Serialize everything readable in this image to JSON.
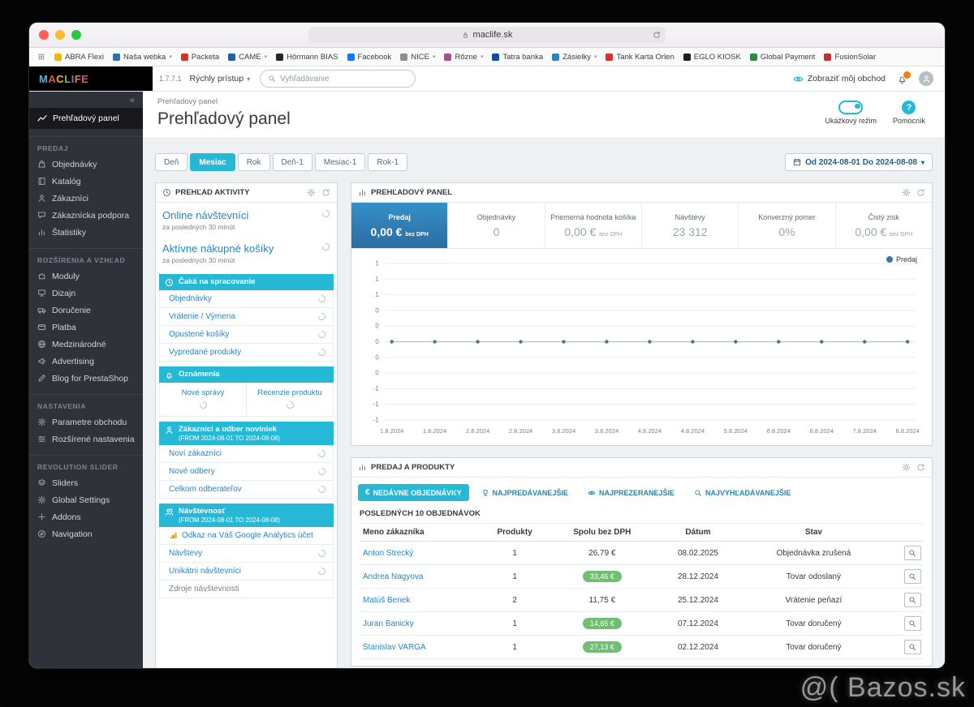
{
  "watermark": "@( Bazos.sk",
  "browser": {
    "address": "maclife.sk",
    "bookmarks_bar": {
      "items": [
        {
          "label": "ABRA Flexi",
          "color": "#f2b705",
          "menu": false
        },
        {
          "label": "Naša webka",
          "color": "#2f6fb2",
          "menu": true
        },
        {
          "label": "Packeta",
          "color": "#d6312b",
          "menu": false
        },
        {
          "label": "CAME",
          "color": "#1b5fae",
          "menu": true
        },
        {
          "label": "Hörmann BIAS",
          "color": "#23272b",
          "menu": false
        },
        {
          "label": "Facebook",
          "color": "#1877f2",
          "menu": false
        },
        {
          "label": "NICE",
          "color": "#8a8f94",
          "menu": true
        },
        {
          "label": "Rôzne",
          "color": "#b04a98",
          "menu": true
        },
        {
          "label": "Tatra banka",
          "color": "#0b4ea2",
          "menu": false
        },
        {
          "label": "Zásielky",
          "color": "#2f80c2",
          "menu": true
        },
        {
          "label": "Tank Karta Orlen",
          "color": "#d6312b",
          "menu": false
        },
        {
          "label": "EGLO KIOSK",
          "color": "#1c1f22",
          "menu": false
        },
        {
          "label": "Global Payment",
          "color": "#2e8b46",
          "menu": false
        },
        {
          "label": "FusionSolar",
          "color": "#c62f2f",
          "menu": false
        }
      ]
    }
  },
  "admin_header": {
    "logo_letters": [
      {
        "ch": "M",
        "color": "#49b8e5"
      },
      {
        "ch": "A",
        "color": "#e8503a"
      },
      {
        "ch": "C",
        "color": "#f5b81c"
      },
      {
        "ch": "L",
        "color": "#6cbf4b"
      },
      {
        "ch": "I",
        "color": "#9a66c6"
      },
      {
        "ch": "F",
        "color": "#f07f28"
      },
      {
        "ch": "E",
        "color": "#e24a7a"
      }
    ],
    "version": "1.7.7.1",
    "quick_access_label": "Rýchly prístup",
    "search_placeholder": "Vyhľadávanie",
    "view_shop_label": "Zobraziť môj obchod"
  },
  "sidebar": {
    "collapse_glyph": "«",
    "active_item": {
      "label": "Prehľadový panel",
      "icon": "chart-line"
    },
    "sections": [
      {
        "heading": "PREDAJ",
        "items": [
          {
            "label": "Objednávky",
            "icon": "bag"
          },
          {
            "label": "Katalóg",
            "icon": "book"
          },
          {
            "label": "Zákazníci",
            "icon": "user"
          },
          {
            "label": "Zákaznícka podpora",
            "icon": "chat"
          },
          {
            "label": "Štatistiky",
            "icon": "bars"
          }
        ]
      },
      {
        "heading": "ROZŠÍRENIA A VZHĽAD",
        "items": [
          {
            "label": "Moduly",
            "icon": "puzzle"
          },
          {
            "label": "Dizajn",
            "icon": "monitor"
          },
          {
            "label": "Doručenie",
            "icon": "truck"
          },
          {
            "label": "Platba",
            "icon": "card"
          },
          {
            "label": "Medzinárodné",
            "icon": "globe"
          },
          {
            "label": "Advertising",
            "icon": "megaphone"
          },
          {
            "label": "Blog for PrestaShop",
            "icon": "pencil"
          }
        ]
      },
      {
        "heading": "NASTAVENIA",
        "items": [
          {
            "label": "Parametre obchodu",
            "icon": "gear"
          },
          {
            "label": "Rozšírené nastavenia",
            "icon": "sliders"
          }
        ]
      },
      {
        "heading": "REVOLUTION SLIDER",
        "items": [
          {
            "label": "Sliders",
            "icon": "layers"
          },
          {
            "label": "Global Settings",
            "icon": "gear"
          },
          {
            "label": "Addons",
            "icon": "plus"
          },
          {
            "label": "Navigation",
            "icon": "compass"
          }
        ]
      }
    ]
  },
  "page": {
    "breadcrumb": "Prehľadový panel",
    "title": "Prehľadový panel",
    "demo_label": "Ukážkový režim",
    "help_label": "Pomocník"
  },
  "toolbar": {
    "range_buttons": [
      "Deň",
      "Mesiac",
      "Rok",
      "Deň-1",
      "Mesiac-1",
      "Rok-1"
    ],
    "active_index": 1,
    "date_range_label": "Od 2024-08-01 Do 2024-08-08"
  },
  "activity_panel": {
    "title": "PREHĽAD AKTIVITY",
    "online_visitors": {
      "label": "Online návštevníci",
      "sub": "za posledných 30 minút"
    },
    "active_carts": {
      "label": "Aktívne nákupné košíky",
      "sub": "za posledných 30 minút"
    },
    "sections": [
      {
        "icon": "clock",
        "heading": "Čaká na spracovanie",
        "links": [
          "Objednávky",
          "Vrátenie / Výmena",
          "Opustené košíky",
          "Vypredané produkty"
        ]
      },
      {
        "icon": "bell",
        "heading": "Oznámenia",
        "cols": [
          "Nové správy",
          "Recenzie produktu"
        ]
      },
      {
        "icon": "user",
        "heading": "Zákazníci a odber noviniek",
        "sub": "(FROM 2024-08-01 TO 2024-08-08)",
        "links": [
          "Noví zákazníci",
          "Nové odbery",
          "Celkom odberateľov"
        ]
      },
      {
        "icon": "users",
        "heading": "Návštevnosť",
        "sub": "(FROM 2024-08-01 TO 2024-08-08)",
        "ga_link": "Odkaz na Váš Google Analytics účet",
        "links": [
          "Návštevy",
          "Unikátni návštevníci"
        ],
        "footer": "Zdroje návštevnosti"
      }
    ]
  },
  "dashboard_panel": {
    "title": "PREHĽADOVÝ PANEL",
    "kpis": [
      {
        "label": "Predaj",
        "value": "0,00 €",
        "suffix": "bez DPH",
        "highlight": true
      },
      {
        "label": "Objednávky",
        "value": "0"
      },
      {
        "label": "Priemerná hodnota košíka",
        "value": "0,00 €",
        "suffix": "bez DPH"
      },
      {
        "label": "Návštevy",
        "value": "23 312"
      },
      {
        "label": "Konverzný pomer",
        "value": "0%"
      },
      {
        "label": "Čistý zisk",
        "value": "0,00 €",
        "suffix": "bez DPH"
      }
    ]
  },
  "chart_data": {
    "type": "line",
    "series": [
      {
        "name": "Predaj",
        "color": "#41749f",
        "values": [
          0,
          0,
          0,
          0,
          0,
          0,
          0,
          0,
          0,
          0,
          0,
          0,
          0
        ]
      }
    ],
    "x_labels": [
      "1.8.2024",
      "1.8.2024",
      "2.8.2024",
      "2.8.2024",
      "3.8.2024",
      "3.8.2024",
      "4.8.2024",
      "4.8.2024",
      "5.8.2024",
      "6.8.2024",
      "6.8.2024",
      "7.8.2024",
      "8.8.2024"
    ],
    "y_tick_labels": [
      "1",
      "1",
      "1",
      "0",
      "0",
      "0",
      "0",
      "0",
      "-1",
      "-1",
      "-1"
    ],
    "ylim": [
      -1,
      1
    ],
    "grid": true,
    "legend_position": "top-right"
  },
  "products_panel": {
    "title": "PREDAJ A PRODUKTY",
    "tabs": [
      {
        "label": "NEDÁVNE OBJEDNÁVKY",
        "icon": "euro",
        "active": true
      },
      {
        "label": "NAJPREDÁVANEJŠIE",
        "icon": "trophy",
        "active": false
      },
      {
        "label": "NAJPREZERANEJŠIE",
        "icon": "eye",
        "active": false
      },
      {
        "label": "NAJVYHĽADÁVANEJŠIE",
        "icon": "search",
        "active": false
      }
    ],
    "caption": "POSLEDNÝCH 10 OBJEDNÁVOK",
    "columns": [
      "Meno zákazníka",
      "Produkty",
      "Spolu bez DPH",
      "Dátum",
      "Stav"
    ],
    "rows": [
      {
        "name": "Anton Strecký",
        "products": "1",
        "total": "26,79 €",
        "badge": false,
        "date": "08.02.2025",
        "status": "Objednávka zrušená"
      },
      {
        "name": "Andrea Nagyova",
        "products": "1",
        "total": "33,46 €",
        "badge": true,
        "date": "28.12.2024",
        "status": "Tovar odoslaný"
      },
      {
        "name": "Matúš Benek",
        "products": "2",
        "total": "11,75 €",
        "badge": false,
        "date": "25.12.2024",
        "status": "Vrátenie peňazí"
      },
      {
        "name": "Juran Banicky",
        "products": "1",
        "total": "14,65 €",
        "badge": true,
        "date": "07.12.2024",
        "status": "Tovar doručený"
      },
      {
        "name": "Stanislav VARGA",
        "products": "1",
        "total": "27,13 €",
        "badge": true,
        "date": "02.12.2024",
        "status": "Tovar doručený"
      }
    ]
  },
  "colors": {
    "accent": "#25b9d7",
    "link": "#2786c7",
    "badge_green": "#6fbe72"
  }
}
